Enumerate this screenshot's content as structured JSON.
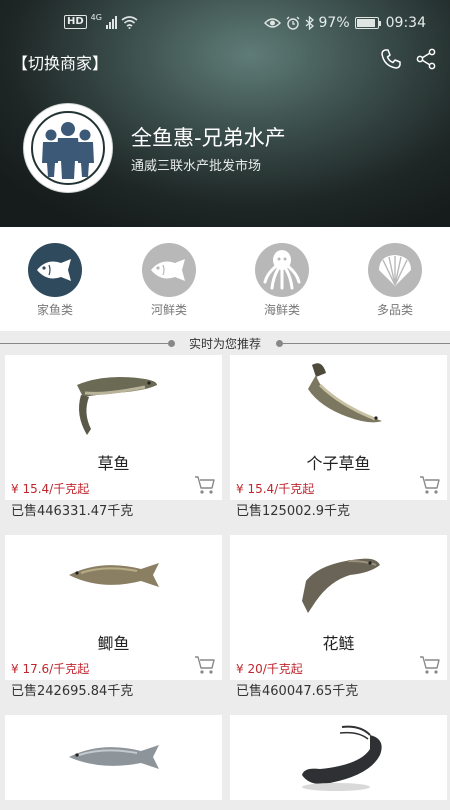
{
  "status_bar": {
    "hd": "HD",
    "network": "4G",
    "battery": "97%",
    "time": "09:34"
  },
  "header": {
    "switch_label": "【切换商家】",
    "shop_name": "全鱼惠-兄弟水产",
    "shop_subtitle": "通威三联水产批发市场",
    "icons": [
      "phone-icon",
      "share-icon"
    ]
  },
  "categories": [
    {
      "label": "家鱼类",
      "icon": "fish-icon",
      "active": true
    },
    {
      "label": "河鲜类",
      "icon": "river-fish-icon",
      "active": false
    },
    {
      "label": "海鲜类",
      "icon": "octopus-icon",
      "active": false
    },
    {
      "label": "多品类",
      "icon": "shell-icon",
      "active": false
    }
  ],
  "recommend_title": "实时为您推荐",
  "products": [
    {
      "name": "草鱼",
      "price": "¥ 15.4/千克起",
      "sold": "已售446331.47千克"
    },
    {
      "name": "个子草鱼",
      "price": "¥ 15.4/千克起",
      "sold": "已售125002.9千克"
    },
    {
      "name": "鲫鱼",
      "price": "¥ 17.6/千克起",
      "sold": "已售242695.84千克"
    },
    {
      "name": "花鲢",
      "price": "¥ 20/千克起",
      "sold": "已售460047.65千克"
    },
    {
      "name": "",
      "price": "",
      "sold": ""
    },
    {
      "name": "",
      "price": "",
      "sold": ""
    }
  ],
  "colors": {
    "price": "#c0262e",
    "active_category": "#2e4a5c",
    "inactive_category": "#b8b8b8"
  }
}
